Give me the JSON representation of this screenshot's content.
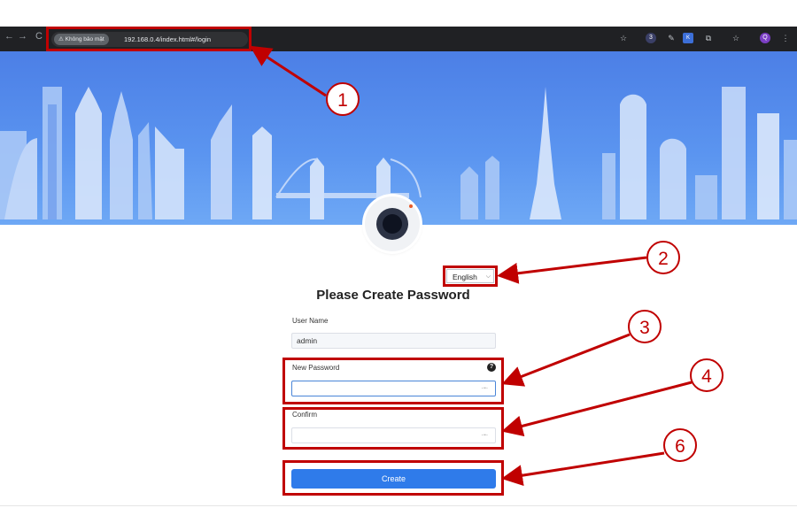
{
  "browser": {
    "security_chip": "Không bảo mật",
    "url": "192.168.0.4/index.html#/login",
    "back_glyph": "←",
    "forward_glyph": "→",
    "reload_glyph": "C",
    "bookmark_glyph": "☆",
    "extension_badge": "3",
    "profile_initial": "Q",
    "menu_glyph": "⋮"
  },
  "form": {
    "language": "English",
    "title": "Please Create Password",
    "username_label": "User Name",
    "username_value": "admin",
    "new_password_label": "New Password",
    "new_password_value": "",
    "confirm_label": "Confirm",
    "confirm_value": "",
    "create_label": "Create",
    "help_glyph": "?",
    "eye_glyph": "·−·"
  },
  "annotations": {
    "callout_1": "1",
    "callout_2": "2",
    "callout_3": "3",
    "callout_4": "4",
    "callout_6": "6",
    "color": "#c00000"
  },
  "icons": [
    "warning-icon",
    "star-icon",
    "pen-icon",
    "extension-icon",
    "puzzle-icon",
    "menu-icon",
    "help-icon",
    "eye-icon",
    "chevron-down-icon",
    "camera-logo"
  ],
  "colors": {
    "accent": "#2f7bea",
    "banner": "#5b95f0",
    "browser_bar": "#202124"
  }
}
